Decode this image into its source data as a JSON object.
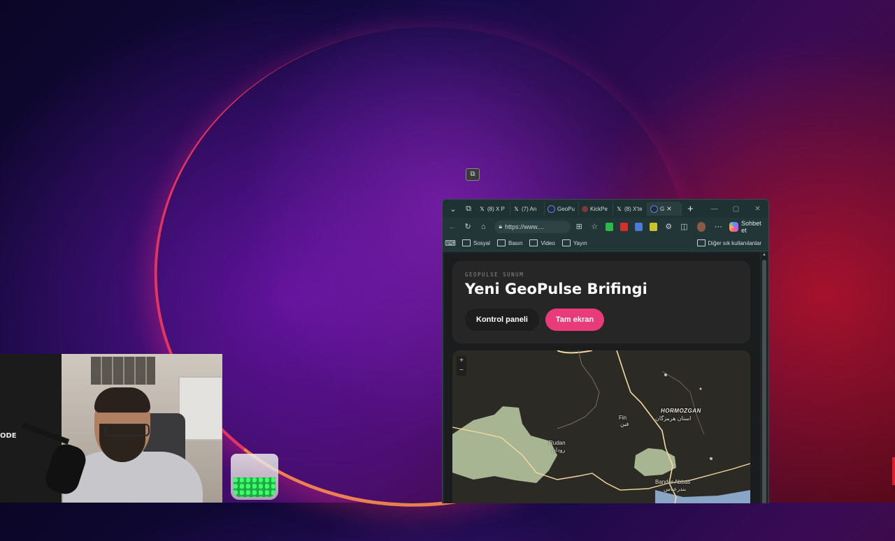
{
  "browser": {
    "tabs": [
      {
        "label": "(8) X P",
        "icon": "x-logo-icon",
        "color": "#000000"
      },
      {
        "label": "(7) An",
        "icon": "x-logo-icon",
        "color": "#000000"
      },
      {
        "label": "GeoPu",
        "icon": "geopulse-icon",
        "color": "#1d2b4f"
      },
      {
        "label": "KickPe",
        "icon": "kick-icon",
        "color": "#7a3a3a"
      },
      {
        "label": "(8) X'te",
        "icon": "x-logo-icon",
        "color": "#000000"
      },
      {
        "label": "G",
        "icon": "geopulse-icon",
        "color": "#1d2b4f",
        "active": true
      }
    ],
    "url": "https://www....",
    "copilot_label": "Sohbet et",
    "bookmarks": [
      "Sosyal",
      "Basın",
      "Video",
      "Yayın"
    ],
    "other_bookmarks": "Diğer sık kullanılanlar"
  },
  "page": {
    "eyebrow": "GEOPULSE SUNUM",
    "title": "Yeni GeoPulse Brifingi",
    "button_dashboard": "Kontrol paneli",
    "button_fullscreen": "Tam ekran"
  },
  "map": {
    "zoom_in": "+",
    "zoom_out": "−",
    "labels": {
      "region": "HORMOZGAN",
      "region_fa": "استان هرمزگان",
      "fin": "Fin",
      "fin_fa": "فين",
      "rudan": "Rudan",
      "rudan_fa": "رودان",
      "bandar": "Bandar Abbas",
      "bandar_fa": "بندرعباس"
    }
  },
  "webcam": {
    "overlay_text": "ODE"
  },
  "colors": {
    "accent_pink": "#e93a79",
    "browser_chrome": "#1f3233",
    "map_land": "#a8b593",
    "map_road": "#f5d9a0"
  }
}
